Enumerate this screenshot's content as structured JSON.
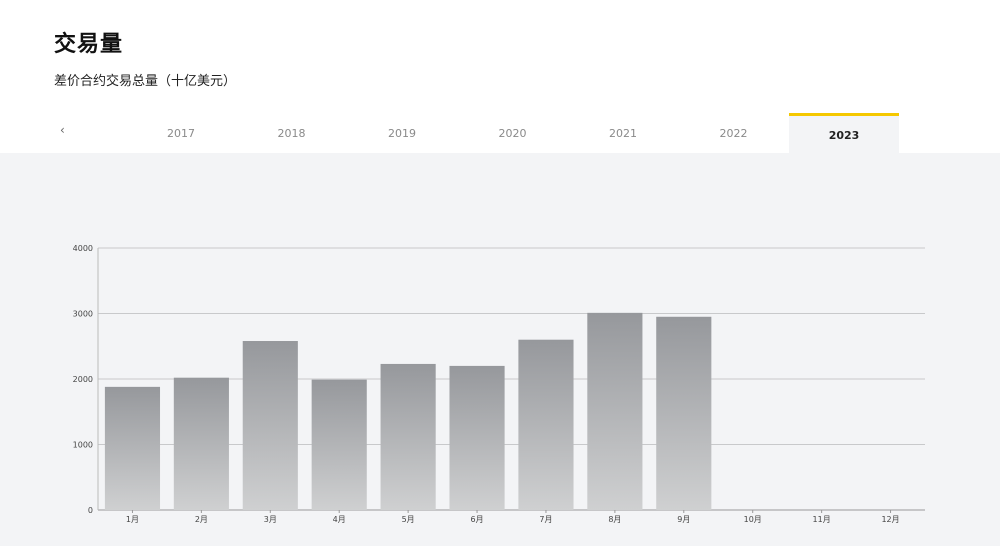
{
  "header": {
    "title": "交易量",
    "subtitle": "差价合约交易总量（十亿美元）"
  },
  "tabs": {
    "prev_icon": "chevron-left-icon",
    "items": [
      "2017",
      "2018",
      "2019",
      "2020",
      "2021",
      "2022",
      "2023"
    ],
    "active": "2023"
  },
  "colors": {
    "accent": "#f5c800",
    "bar_top": "#96989c",
    "bar_bottom": "#cfd0d1",
    "background": "#f3f4f6"
  },
  "chart_data": {
    "type": "bar",
    "categories": [
      "1月",
      "2月",
      "3月",
      "4月",
      "5月",
      "6月",
      "7月",
      "8月",
      "9月",
      "10月",
      "11月",
      "12月"
    ],
    "values": [
      1880,
      2020,
      2580,
      1990,
      2230,
      2200,
      2600,
      3010,
      2950,
      0,
      0,
      0
    ],
    "yticks": [
      0,
      1000,
      2000,
      3000,
      4000
    ],
    "ylim": [
      0,
      4000
    ],
    "grid": true
  }
}
